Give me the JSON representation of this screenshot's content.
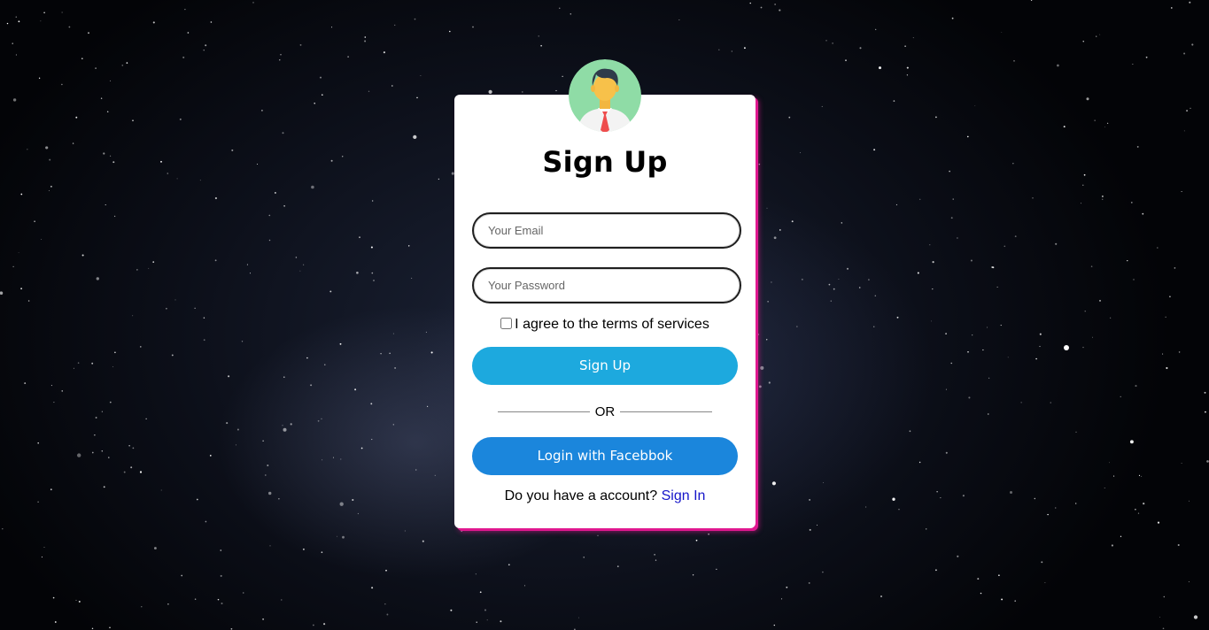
{
  "colors": {
    "card_background": "#ffffff",
    "card_glow": "#e0188f",
    "signup_button": "#1da9de",
    "facebook_button": "#1b86dc",
    "link": "#1515c9",
    "avatar_bg": "#8fdca6"
  },
  "avatar": {
    "icon": "user-avatar-icon"
  },
  "form": {
    "title": "Sign Up",
    "email_placeholder": "Your Email",
    "password_placeholder": "Your Password",
    "terms_label": "I agree to the terms of services",
    "terms_checked": false,
    "signup_button": "Sign Up",
    "divider_text": "OR",
    "facebook_button": "Login with Facebbok",
    "account_prompt": "Do you have a account?",
    "signin_link": "Sign In"
  }
}
